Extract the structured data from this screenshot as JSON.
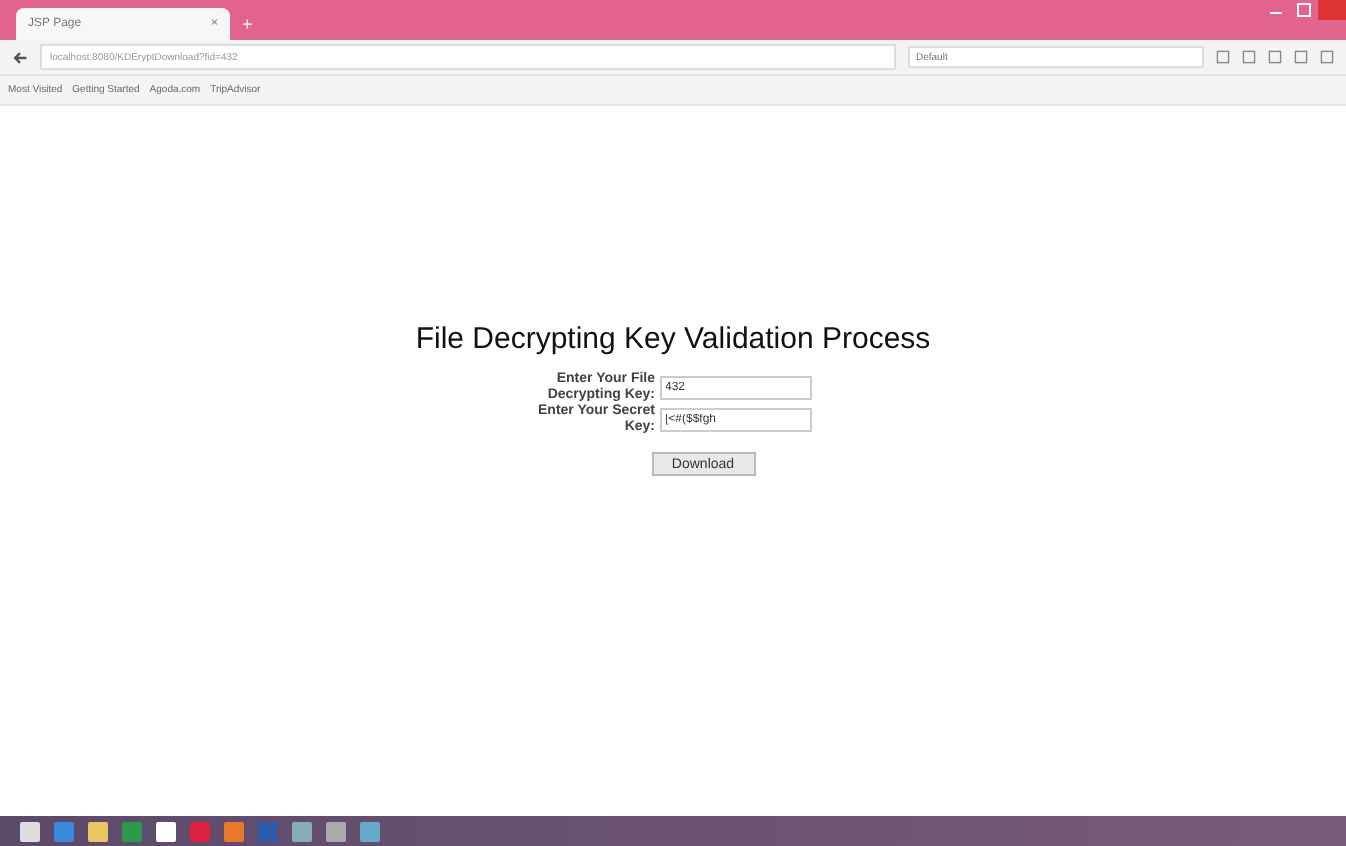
{
  "browser": {
    "tab": {
      "title": "JSP Page",
      "close": "×"
    },
    "new_tab": "+",
    "url": "localhost:8080/KDEryptDownload?fid=432",
    "search": {
      "placeholder": "Default"
    },
    "bookmarks": [
      "Most Visited",
      "Getting Started",
      "Agoda.com",
      "TripAdvisor"
    ]
  },
  "form": {
    "title": "File Decrypting Key Validation Process",
    "fields": [
      {
        "label": "Enter Your File Decrypting Key:",
        "value": "432"
      },
      {
        "label": "Enter Your Secret Key:",
        "value": "[<#($$fgh"
      }
    ],
    "button": "Download"
  }
}
